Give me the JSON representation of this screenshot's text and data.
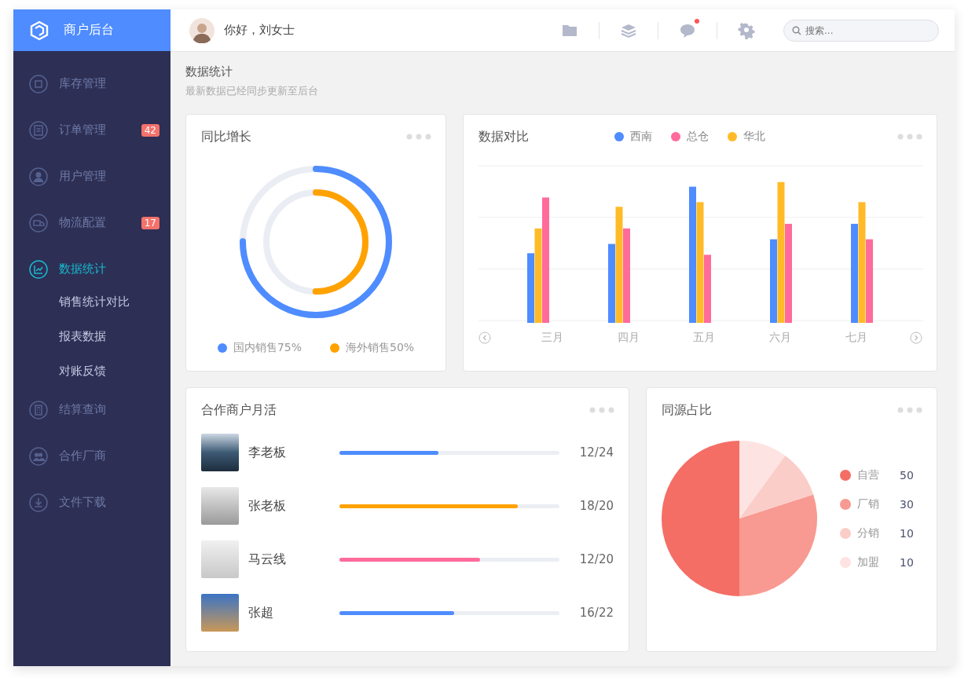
{
  "sidebar": {
    "brand": "商户后台",
    "items": [
      {
        "label": "库存管理",
        "selected": false
      },
      {
        "label": "订单管理",
        "badge": "42",
        "selected": false
      },
      {
        "label": "用户管理",
        "selected": false
      },
      {
        "label": "物流配置",
        "badge": "17",
        "selected": false
      },
      {
        "label": "数据统计",
        "selected": true,
        "children": [
          {
            "label": "销售统计对比"
          },
          {
            "label": "报表数据"
          },
          {
            "label": "对账反馈"
          }
        ]
      },
      {
        "label": "结算查询",
        "selected": false
      },
      {
        "label": "合作厂商",
        "selected": false
      },
      {
        "label": "文件下载",
        "selected": false
      }
    ]
  },
  "header": {
    "greeting": "你好，刘女士",
    "messages_unread": true,
    "search": {
      "placeholder": "搜索..."
    }
  },
  "page": {
    "title": "数据统计",
    "subtitle": "最新数据已经同步更新至后台"
  },
  "growth_card": {
    "title": "同比增长",
    "rings": [
      {
        "label": "国内销售75%",
        "color": "#4e8cff",
        "level": 0.75
      },
      {
        "label": "海外销售50%",
        "color": "#ffa200",
        "level": 0.5
      }
    ]
  },
  "compare_card": {
    "title": "数据对比",
    "legend": [
      {
        "label": "西南",
        "color": "#4e8cff"
      },
      {
        "label": "总仓",
        "color": "#ff6b9a"
      },
      {
        "label": "华北",
        "color": "#ffbb27"
      }
    ],
    "months": [
      "三月",
      "四月",
      "五月",
      "六月",
      "七月"
    ]
  },
  "merchants_card": {
    "title": "合作商户月活",
    "rows": [
      {
        "name": "李老板",
        "level": 0.45,
        "reading": "12/24",
        "color": "#4e8cff"
      },
      {
        "name": "张老板",
        "level": 0.81,
        "reading": "18/20",
        "color": "#ffa200"
      },
      {
        "name": "马云线",
        "level": 0.64,
        "reading": "12/20",
        "color": "#ff6b9a"
      },
      {
        "name": "张超",
        "level": 0.52,
        "reading": "16/22",
        "color": "#4e8cff"
      }
    ]
  },
  "source_card": {
    "title": "同源占比",
    "chart_data": {
      "type": "pie",
      "categories": [
        "自营",
        "厂销",
        "分销",
        "加盟"
      ],
      "values": [
        50,
        30,
        10,
        10
      ]
    },
    "legend": [
      {
        "value": "50",
        "color": "#f46e65"
      },
      {
        "value": "30",
        "color": "#f89a91"
      },
      {
        "value": "10",
        "color": "#fbcdc8"
      },
      {
        "value": "10",
        "color": "#fde3e1"
      }
    ]
  }
}
